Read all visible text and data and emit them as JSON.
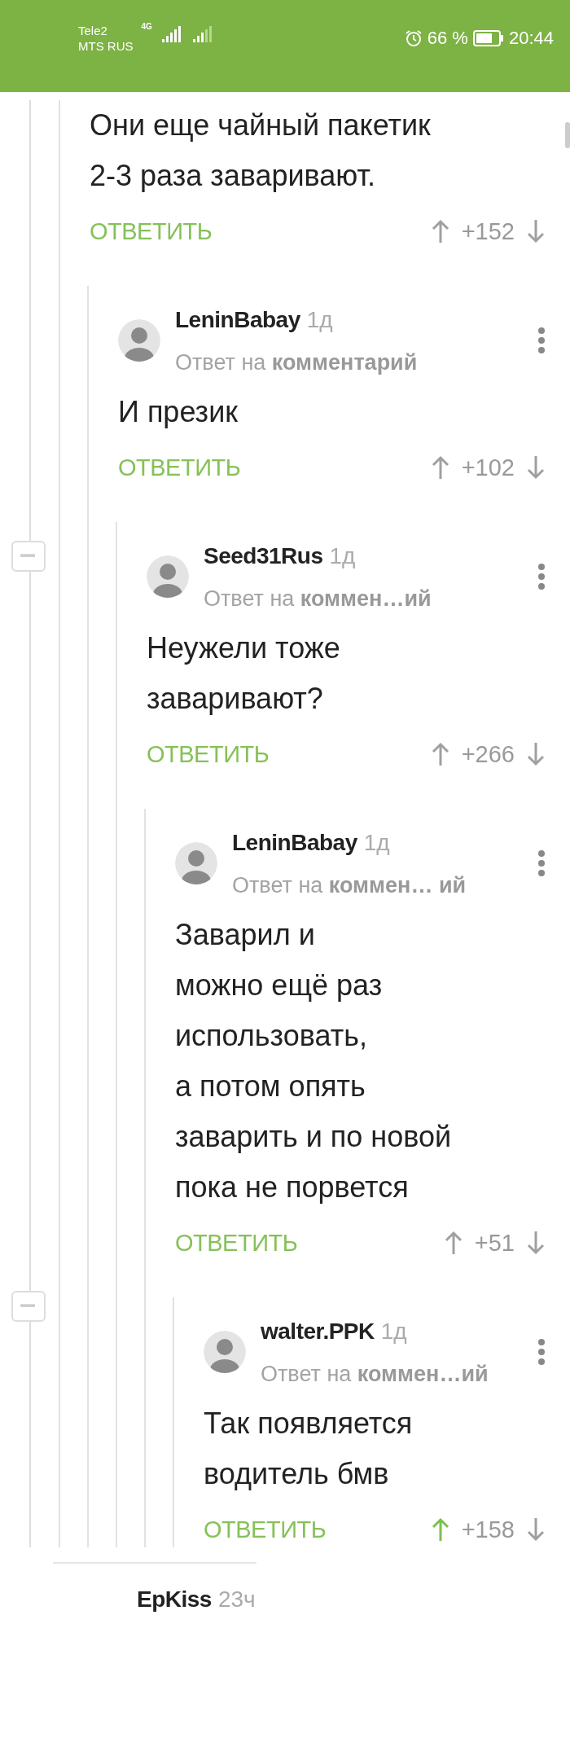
{
  "status_bar": {
    "carrier_1": "Tele2",
    "carrier_2": "MTS RUS",
    "network": "4G",
    "battery": "66 %",
    "time": "20:44"
  },
  "comments": [
    {
      "body": "Они еще чайный пакетик\n2-3 раза заваривают.",
      "reply_button": "ОТВЕТИТЬ",
      "score": "+152",
      "upvoted": false,
      "children": [
        {
          "author": "LeninBabay",
          "time": "1д",
          "reply_to": "Ответ на **комментарий**",
          "body": "И презик",
          "reply_button": "ОТВЕТИТЬ",
          "score": "+102",
          "upvoted": false,
          "children": [
            {
              "author": "Seed31Rus",
              "time": "1д",
              "reply_to": "Ответ на **коммен…ий**",
              "body": "Неужели тоже\nзаваривают?",
              "reply_button": "ОТВЕТИТЬ",
              "score": "+266",
              "upvoted": false,
              "children": [
                {
                  "author": "LeninBabay",
                  "time": "1д",
                  "reply_to": "Ответ на **коммен…** **ий**",
                  "body": "Заварил и\nможно ещё раз\nиспользовать,\nа потом опять\nзаварить и по новой\nпока не порвется",
                  "reply_button": "ОТВЕТИТЬ",
                  "score": "+51",
                  "upvoted": false,
                  "children": [
                    {
                      "author": "walter.PPK",
                      "time": "1д",
                      "reply_to": "Ответ на **коммен…ий**",
                      "body": "Так появляется\nводитель бмв",
                      "reply_button": "ОТВЕТИТЬ",
                      "score": "+158",
                      "upvoted": true
                    }
                  ]
                }
              ]
            }
          ]
        }
      ]
    }
  ],
  "next_comment": {
    "author": "EpKiss",
    "time": "23ч"
  }
}
